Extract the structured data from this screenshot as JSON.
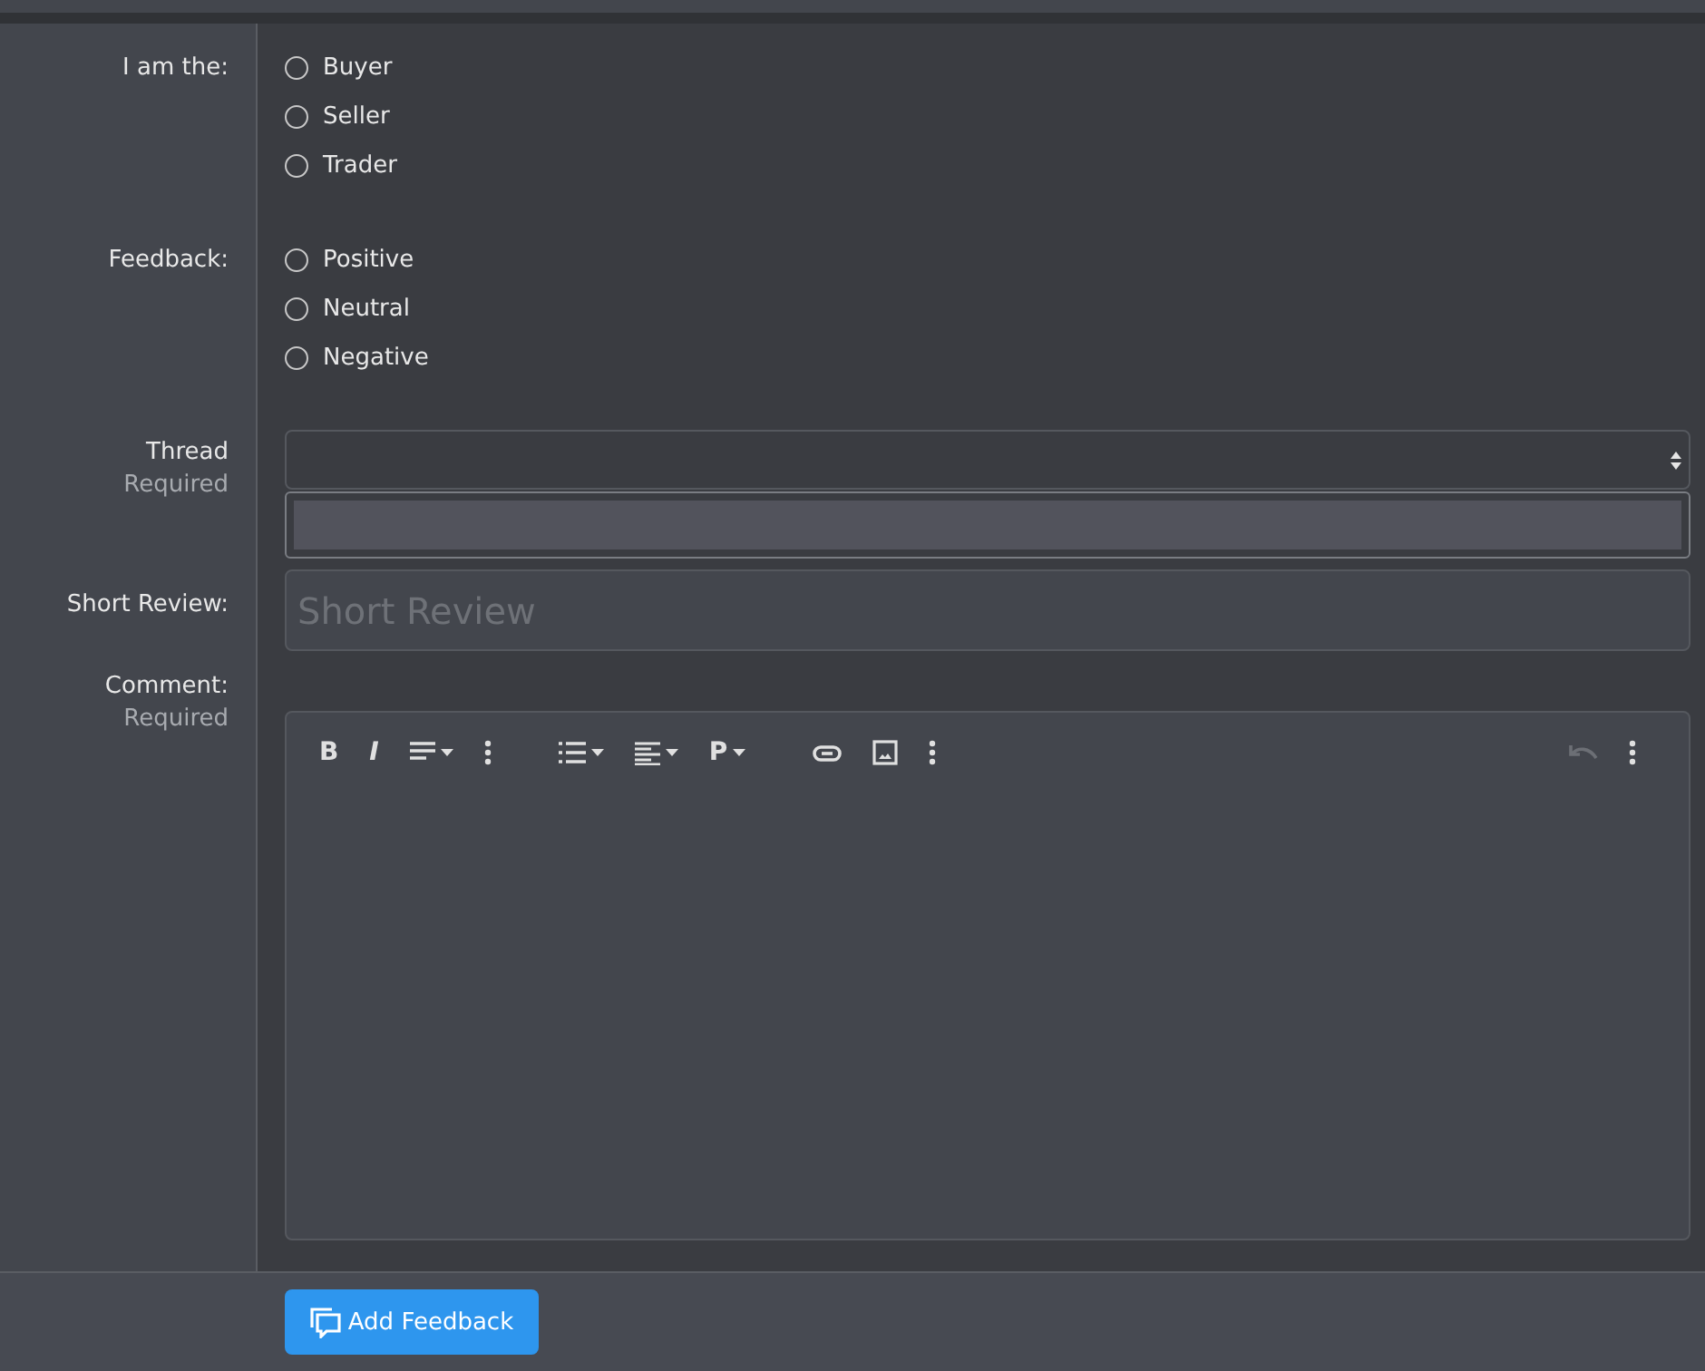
{
  "role": {
    "label": "I am the:",
    "options": [
      {
        "label": "Buyer",
        "selected": false
      },
      {
        "label": "Seller",
        "selected": false
      },
      {
        "label": "Trader",
        "selected": false
      }
    ]
  },
  "feedback": {
    "label": "Feedback:",
    "options": [
      {
        "label": "Positive",
        "selected": false
      },
      {
        "label": "Neutral",
        "selected": false
      },
      {
        "label": "Negative",
        "selected": false
      }
    ]
  },
  "thread": {
    "label": "Thread",
    "hint": "Required",
    "expanded": true
  },
  "short_review": {
    "label": "Short Review:",
    "placeholder": "Short Review"
  },
  "comment": {
    "label": "Comment:",
    "hint": "Required",
    "toolbar": [
      {
        "kind": "bold",
        "label": "B"
      },
      {
        "kind": "italic",
        "label": "I"
      },
      {
        "kind": "paragraph"
      },
      {
        "kind": "more"
      },
      {
        "kind": "gap"
      },
      {
        "kind": "list"
      },
      {
        "kind": "align"
      },
      {
        "kind": "format",
        "label": "P"
      },
      {
        "kind": "gap"
      },
      {
        "kind": "link"
      },
      {
        "kind": "image"
      },
      {
        "kind": "more"
      },
      {
        "kind": "spacer"
      },
      {
        "kind": "undo",
        "disabled": true
      },
      {
        "kind": "more"
      }
    ]
  },
  "submit": {
    "label": "Add Feedback"
  }
}
